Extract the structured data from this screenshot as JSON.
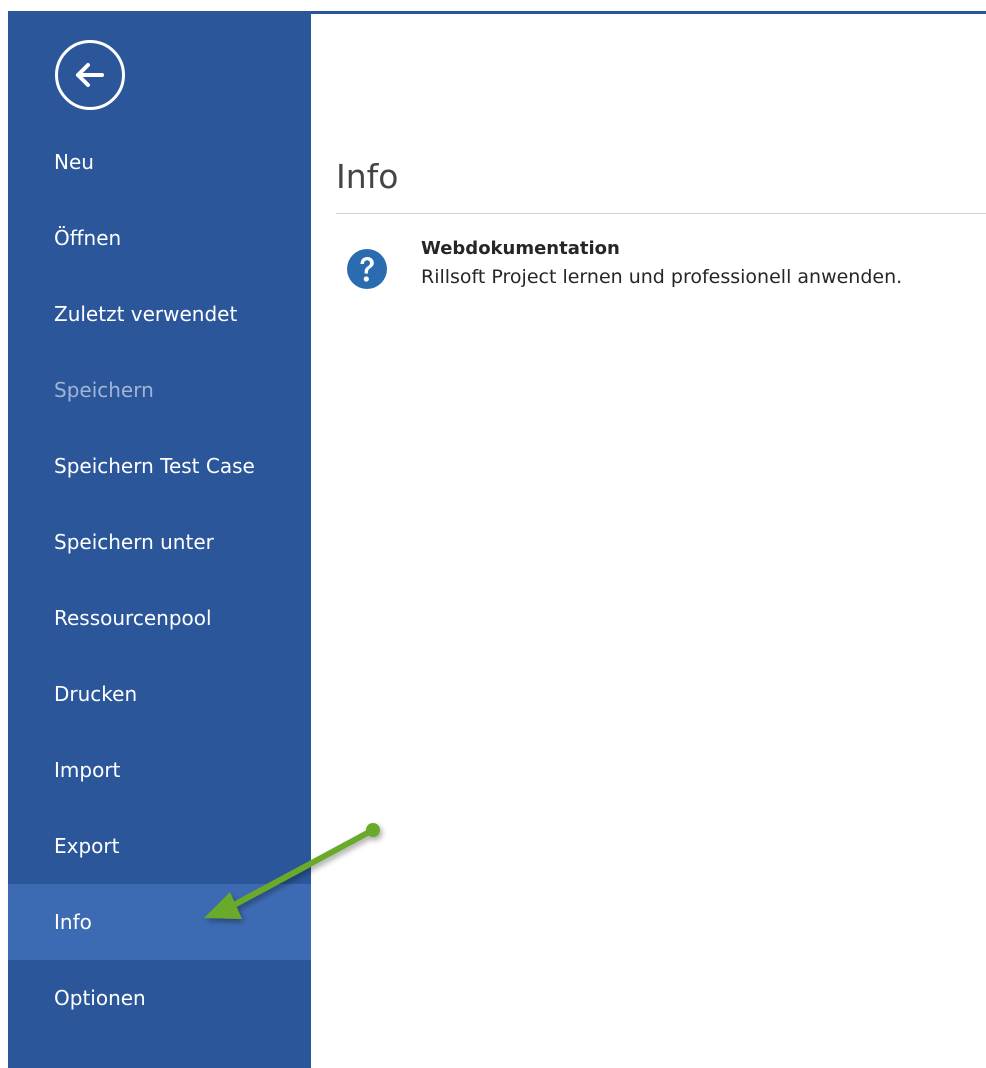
{
  "sidebar": {
    "back_icon": "arrow-left-circle-icon",
    "items": [
      {
        "label": "Neu",
        "state": "normal"
      },
      {
        "label": "Öffnen",
        "state": "normal"
      },
      {
        "label": "Zuletzt verwendet",
        "state": "normal"
      },
      {
        "label": "Speichern",
        "state": "disabled"
      },
      {
        "label": "Speichern Test Case",
        "state": "normal"
      },
      {
        "label": "Speichern unter",
        "state": "normal"
      },
      {
        "label": "Ressourcenpool",
        "state": "normal"
      },
      {
        "label": "Drucken",
        "state": "normal"
      },
      {
        "label": "Import",
        "state": "normal"
      },
      {
        "label": "Export",
        "state": "normal"
      },
      {
        "label": "Info",
        "state": "active"
      },
      {
        "label": "Optionen",
        "state": "normal"
      }
    ]
  },
  "main": {
    "title": "Info",
    "entries": [
      {
        "icon": "help-icon",
        "heading": "Webdokumentation",
        "description": "Rillsoft Project lernen und professionell anwenden."
      }
    ]
  },
  "annotation": {
    "type": "arrow",
    "color": "#6aaa2b",
    "points_to": "Info"
  },
  "colors": {
    "sidebar_bg": "#2b579a",
    "sidebar_active": "#3d6bb3",
    "sidebar_disabled_text": "#9fb4d6",
    "help_icon": "#2b6cb0"
  }
}
